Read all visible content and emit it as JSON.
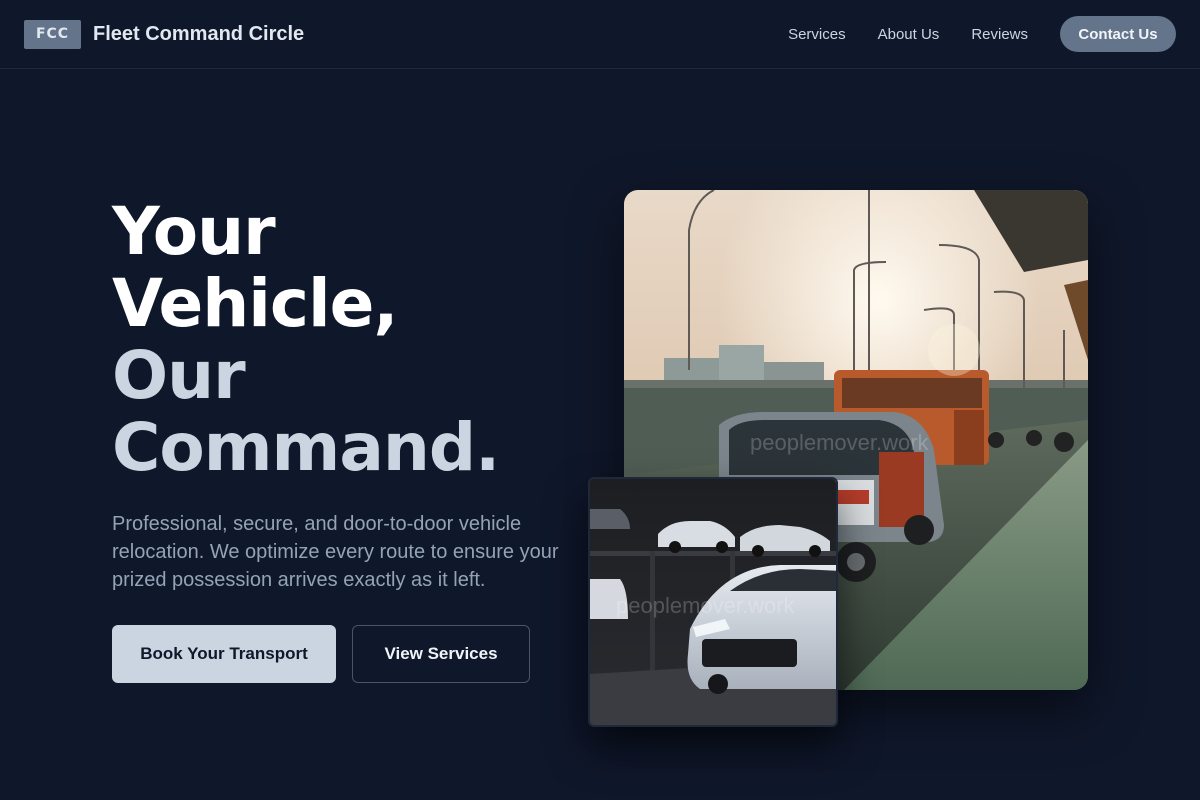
{
  "header": {
    "logo_text": "FCC",
    "brand_name": "Fleet Command Circle",
    "nav": [
      "Services",
      "About Us",
      "Reviews"
    ],
    "contact_label": "Contact Us"
  },
  "hero": {
    "headline_line1": "Your",
    "headline_line2": "Vehicle,",
    "headline_line3": "Our",
    "headline_line4": "Command.",
    "subtext": "Professional, secure, and door-to-door vehicle relocation. We optimize every route to ensure your prized possession arrives exactly as it left.",
    "primary_button": "Book Your Transport",
    "secondary_button": "View Services"
  },
  "images": {
    "main_watermark": "peoplemover.work",
    "small_watermark": "peoplemover.work"
  },
  "colors": {
    "background": "#0f172a",
    "accent": "#64748b",
    "headline_light": "#ffffff",
    "headline_muted": "#cbd5e1",
    "body_text": "#94a3b8"
  }
}
